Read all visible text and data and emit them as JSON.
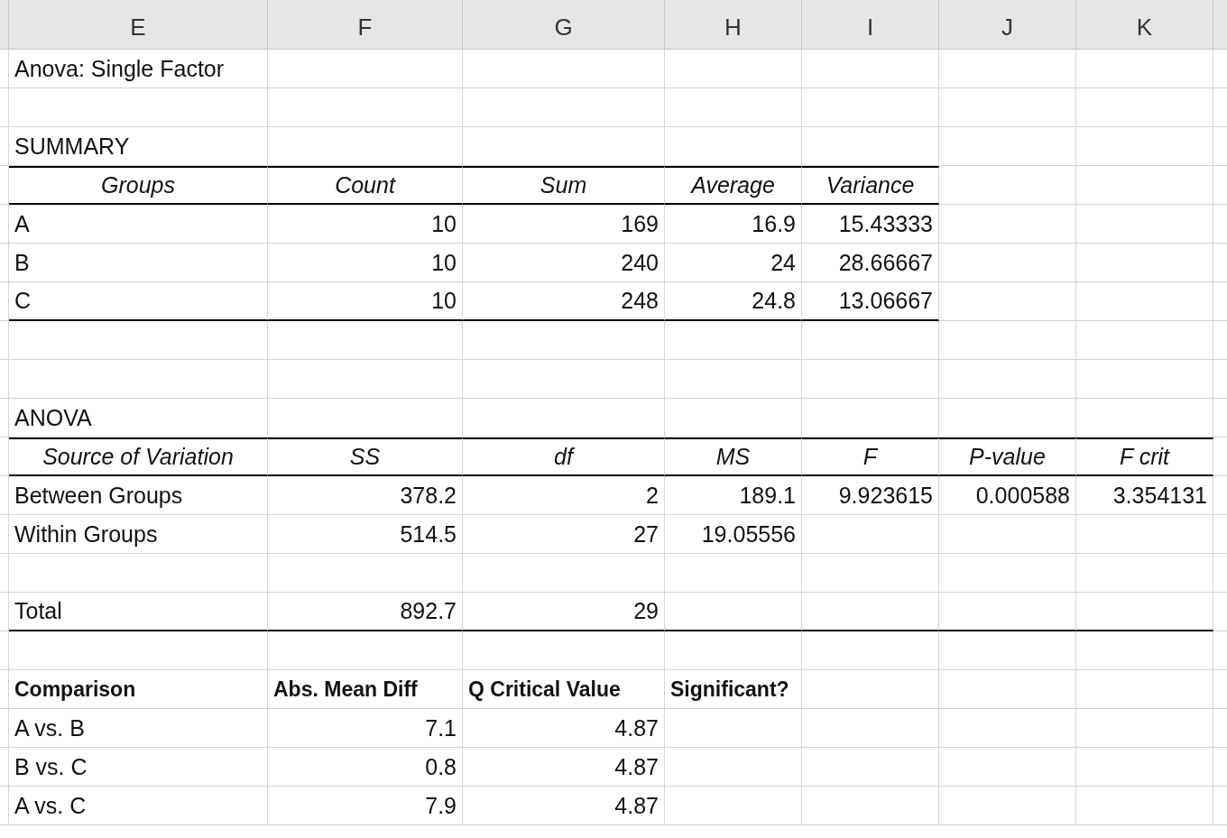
{
  "columns": [
    "E",
    "F",
    "G",
    "H",
    "I",
    "J",
    "K"
  ],
  "rows": [
    {
      "cells": [
        {
          "text": "Anova: Single Factor"
        },
        {},
        {},
        {},
        {},
        {},
        {}
      ]
    },
    {
      "cells": [
        {},
        {},
        {},
        {},
        {},
        {},
        {}
      ]
    },
    {
      "cells": [
        {
          "text": "SUMMARY"
        },
        {},
        {},
        {},
        {},
        {},
        {}
      ]
    },
    {
      "cells": [
        {
          "text": "Groups",
          "heading": true,
          "rule_top": true,
          "rule_bottom": true
        },
        {
          "text": "Count",
          "heading": true,
          "rule_top": true,
          "rule_bottom": true
        },
        {
          "text": "Sum",
          "heading": true,
          "rule_top": true,
          "rule_bottom": true
        },
        {
          "text": "Average",
          "heading": true,
          "rule_top": true,
          "rule_bottom": true
        },
        {
          "text": "Variance",
          "heading": true,
          "rule_top": true,
          "rule_bottom": true
        },
        {},
        {}
      ]
    },
    {
      "cells": [
        {
          "text": "A"
        },
        {
          "text": "10",
          "numeric": true
        },
        {
          "text": "169",
          "numeric": true
        },
        {
          "text": "16.9",
          "numeric": true
        },
        {
          "text": "15.43333",
          "numeric": true
        },
        {},
        {}
      ]
    },
    {
      "cells": [
        {
          "text": "B"
        },
        {
          "text": "10",
          "numeric": true
        },
        {
          "text": "240",
          "numeric": true
        },
        {
          "text": "24",
          "numeric": true
        },
        {
          "text": "28.66667",
          "numeric": true
        },
        {},
        {}
      ]
    },
    {
      "cells": [
        {
          "text": "C",
          "rule_bottom": true
        },
        {
          "text": "10",
          "numeric": true,
          "rule_bottom": true
        },
        {
          "text": "248",
          "numeric": true,
          "rule_bottom": true
        },
        {
          "text": "24.8",
          "numeric": true,
          "rule_bottom": true
        },
        {
          "text": "13.06667",
          "numeric": true,
          "rule_bottom": true
        },
        {},
        {}
      ]
    },
    {
      "cells": [
        {},
        {},
        {},
        {},
        {},
        {},
        {}
      ]
    },
    {
      "cells": [
        {},
        {},
        {},
        {},
        {},
        {},
        {}
      ]
    },
    {
      "cells": [
        {
          "text": "ANOVA"
        },
        {},
        {},
        {},
        {},
        {},
        {}
      ]
    },
    {
      "cells": [
        {
          "text": "Source of Variation",
          "heading": true,
          "rule_top": true,
          "rule_bottom": true
        },
        {
          "text": "SS",
          "heading": true,
          "rule_top": true,
          "rule_bottom": true
        },
        {
          "text": "df",
          "heading": true,
          "rule_top": true,
          "rule_bottom": true
        },
        {
          "text": "MS",
          "heading": true,
          "rule_top": true,
          "rule_bottom": true
        },
        {
          "text": "F",
          "heading": true,
          "rule_top": true,
          "rule_bottom": true
        },
        {
          "text": "P-value",
          "heading": true,
          "rule_top": true,
          "rule_bottom": true
        },
        {
          "text": "F crit",
          "heading": true,
          "rule_top": true,
          "rule_bottom": true
        }
      ]
    },
    {
      "cells": [
        {
          "text": "Between Groups"
        },
        {
          "text": "378.2",
          "numeric": true
        },
        {
          "text": "2",
          "numeric": true
        },
        {
          "text": "189.1",
          "numeric": true
        },
        {
          "text": "9.923615",
          "numeric": true
        },
        {
          "text": "0.000588",
          "numeric": true
        },
        {
          "text": "3.354131",
          "numeric": true
        }
      ]
    },
    {
      "cells": [
        {
          "text": "Within Groups"
        },
        {
          "text": "514.5",
          "numeric": true
        },
        {
          "text": "27",
          "numeric": true
        },
        {
          "text": "19.05556",
          "numeric": true
        },
        {},
        {},
        {}
      ]
    },
    {
      "cells": [
        {},
        {},
        {},
        {},
        {},
        {},
        {}
      ]
    },
    {
      "cells": [
        {
          "text": "Total",
          "rule_bottom": true
        },
        {
          "text": "892.7",
          "numeric": true,
          "rule_bottom": true
        },
        {
          "text": "29",
          "numeric": true,
          "rule_bottom": true
        },
        {
          "rule_bottom": true
        },
        {
          "rule_bottom": true
        },
        {
          "rule_bottom": true
        },
        {
          "rule_bottom": true
        }
      ]
    },
    {
      "cells": [
        {},
        {},
        {},
        {},
        {},
        {},
        {}
      ]
    },
    {
      "cells": [
        {
          "text": "Comparison",
          "bold": true
        },
        {
          "text": "Abs. Mean Diff",
          "bold": true
        },
        {
          "text": "Q Critical Value",
          "bold": true
        },
        {
          "text": "Significant?",
          "bold": true
        },
        {},
        {},
        {}
      ]
    },
    {
      "cells": [
        {
          "text": "A vs. B"
        },
        {
          "text": "7.1",
          "numeric": true
        },
        {
          "text": "4.87",
          "numeric": true
        },
        {},
        {},
        {},
        {}
      ]
    },
    {
      "cells": [
        {
          "text": "B vs. C"
        },
        {
          "text": "0.8",
          "numeric": true
        },
        {
          "text": "4.87",
          "numeric": true
        },
        {},
        {},
        {},
        {}
      ]
    },
    {
      "cells": [
        {
          "text": "A vs. C"
        },
        {
          "text": "7.9",
          "numeric": true
        },
        {
          "text": "4.87",
          "numeric": true
        },
        {},
        {},
        {},
        {}
      ]
    }
  ]
}
